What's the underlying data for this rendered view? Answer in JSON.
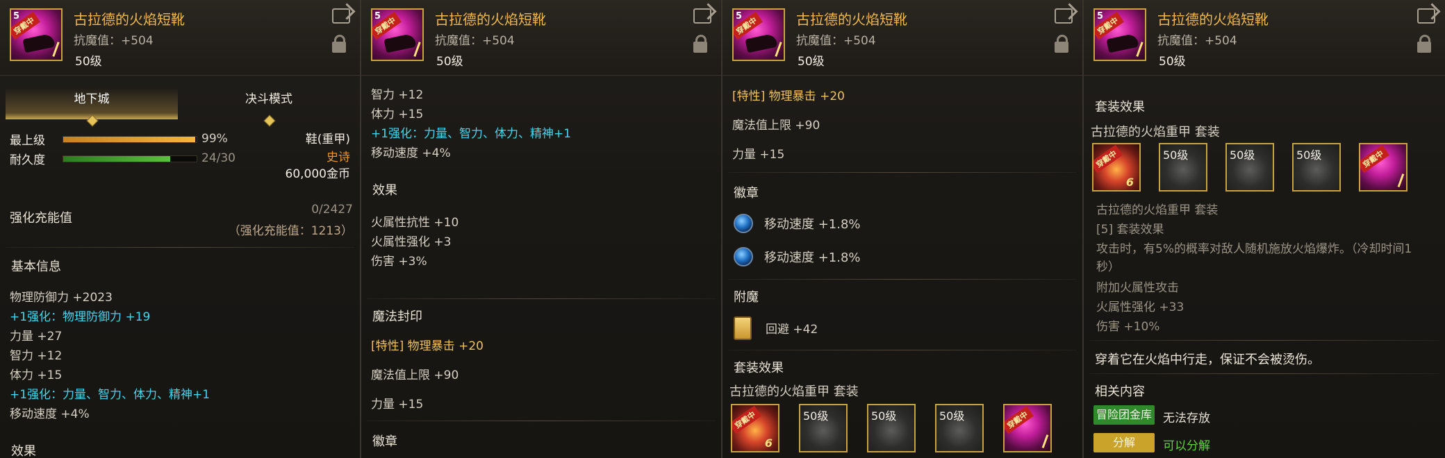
{
  "item": {
    "name": "古拉德的火焰短靴",
    "resist": "抗魔值：+504",
    "level": "50级",
    "icon_number": "5",
    "icon_tag": "穿戴中"
  },
  "p1": {
    "tabs": [
      "地下城",
      "决斗模式"
    ],
    "max_level_label": "最上级",
    "max_level_value": "99%",
    "max_level_fill": 0.99,
    "durability_label": "耐久度",
    "durability_value": "24/30",
    "durability_fill": 0.8,
    "slot": "鞋(重甲)",
    "rarity": "史诗",
    "price": "60,000金币",
    "charge_label": "强化充能值",
    "charge_value": "0/2427",
    "charge_detail": "（强化充能值：1213）",
    "basic_title": "基本信息",
    "lines": [
      {
        "t": "物理防御力 +2023",
        "c": "white"
      },
      {
        "t": "+1强化：物理防御力 +19",
        "c": "cyan"
      },
      {
        "t": "力量 +27",
        "c": "white"
      },
      {
        "t": "智力 +12",
        "c": "white"
      },
      {
        "t": "体力 +15",
        "c": "white"
      },
      {
        "t": "+1强化：力量、智力、体力、精神+1",
        "c": "cyan"
      },
      {
        "t": "移动速度 +4%",
        "c": "white"
      },
      {
        "t": "效果",
        "c": "head"
      }
    ]
  },
  "p2": {
    "top_lines": [
      {
        "t": "力量 +27",
        "c": "white"
      },
      {
        "t": "智力 +12",
        "c": "white"
      },
      {
        "t": "体力 +15",
        "c": "white"
      },
      {
        "t": "+1强化：力量、智力、体力、精神+1",
        "c": "cyan"
      },
      {
        "t": "移动速度 +4%",
        "c": "white"
      }
    ],
    "effect_title": "效果",
    "effects": [
      "火属性抗性 +10",
      "火属性强化 +3",
      "伤害 +3%"
    ],
    "seal_title": "魔法封印",
    "seal_special": "[特性] 物理暴击 +20",
    "seal_mp": "魔法值上限 +90",
    "seal_str": "力量 +15",
    "emblem_title": "徽章"
  },
  "p3": {
    "seal_special": "[特性] 物理暴击 +20",
    "seal_mp": "魔法值上限 +90",
    "seal_str": "力量 +15",
    "emblem_title": "徽章",
    "emblems": [
      "移动速度 +1.8%",
      "移动速度 +1.8%"
    ],
    "enchant_title": "附魔",
    "enchant": "回避 +42",
    "set_title": "套装效果",
    "set_name": "古拉德的火焰重甲  套装",
    "set_levels": [
      "50级",
      "50级",
      "50级"
    ]
  },
  "p4": {
    "set_title": "套装效果",
    "set_name": "古拉德的火焰重甲  套装",
    "set_levels": [
      "50级",
      "50级",
      "50级"
    ],
    "set_name2": "古拉德的火焰重甲  套装",
    "set_bonus": "[5] 套装效果",
    "set_desc1": "攻击时，有5%的概率对敌人随机施放火焰爆炸。（冷却时间1",
    "set_desc2": "秒）",
    "set_attack": "附加火属性攻击",
    "set_fire": "火属性强化 +33",
    "set_dmg": "伤害 +10%",
    "flavor": "穿着它在火焰中行走，保证不会被烫伤。",
    "related_title": "相关内容",
    "vault_btn": "冒险团金库",
    "vault_text": "无法存放",
    "decompose_btn": "分解",
    "decompose_text": "可以分解"
  }
}
